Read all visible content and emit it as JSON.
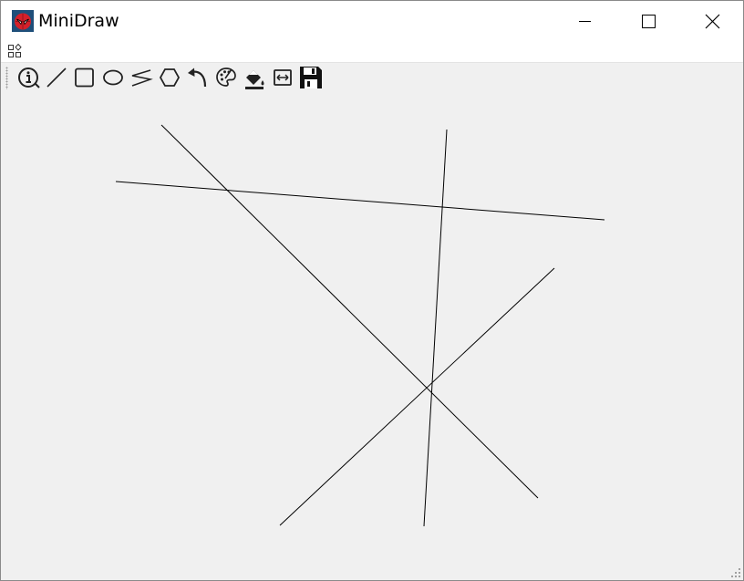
{
  "window": {
    "title": "MiniDraw",
    "app_icon": "spider-mask-icon",
    "controls": [
      {
        "name": "minimize",
        "icon": "minimize-icon"
      },
      {
        "name": "maximize",
        "icon": "maximize-icon"
      },
      {
        "name": "close",
        "icon": "close-icon"
      }
    ]
  },
  "menubar": {
    "icon": "widgets-icon"
  },
  "toolbar": {
    "tools": [
      {
        "name": "about",
        "icon": "info-icon"
      },
      {
        "name": "line",
        "icon": "line-icon"
      },
      {
        "name": "rectangle",
        "icon": "rectangle-icon"
      },
      {
        "name": "ellipse",
        "icon": "ellipse-icon"
      },
      {
        "name": "freehand",
        "icon": "polyline-icon"
      },
      {
        "name": "polygon",
        "icon": "hexagon-icon"
      },
      {
        "name": "undo",
        "icon": "undo-arrow-icon"
      },
      {
        "name": "color",
        "icon": "palette-icon"
      },
      {
        "name": "fill",
        "icon": "paint-bucket-icon"
      },
      {
        "name": "width",
        "icon": "resize-horizontal-icon"
      },
      {
        "name": "save",
        "icon": "floppy-disk-icon"
      }
    ]
  },
  "colors": {
    "canvas_bg": "#f0f0f0",
    "stroke": "#000000",
    "toolbar_bg": "#f0f0f0",
    "title_bg": "#ffffff"
  }
}
